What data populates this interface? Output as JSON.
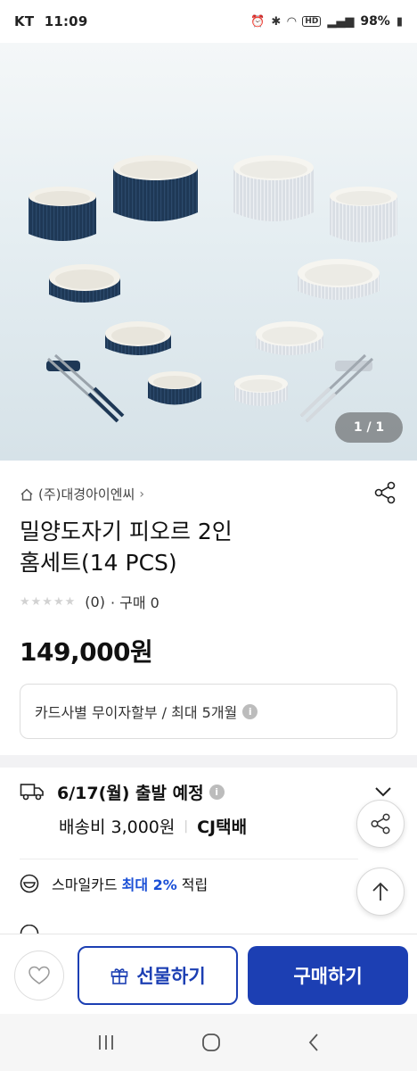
{
  "status_bar": {
    "carrier": "KT",
    "time": "11:09",
    "battery": "98%",
    "network": "HD"
  },
  "gallery": {
    "counter": "1 / 1"
  },
  "product": {
    "brand": "(주)대경아이엔씨",
    "title_line1": "밀양도자기 피오르 2인",
    "title_line2": "홈세트(14 PCS)",
    "rating_stars": 0,
    "review_count": "(0)",
    "purchase_label": "· 구매 0",
    "price": "149,000원"
  },
  "installment": {
    "text": "카드사별 무이자할부 / 최대 5개월"
  },
  "shipping": {
    "date_text": "6/17(월) 출발 예정",
    "fee": "배송비 3,000원",
    "carrier": "CJ택배"
  },
  "card_benefit": {
    "prefix": "스마일카드",
    "highlight": "최대 2%",
    "suffix": "적립"
  },
  "actions": {
    "gift_label": "선물하기",
    "buy_label": "구매하기"
  },
  "colors": {
    "primary": "#1c3fb3",
    "highlight": "#1a4fd6",
    "navy_bowl": "#1f3a5a",
    "white_bowl": "#e8ecf0"
  }
}
